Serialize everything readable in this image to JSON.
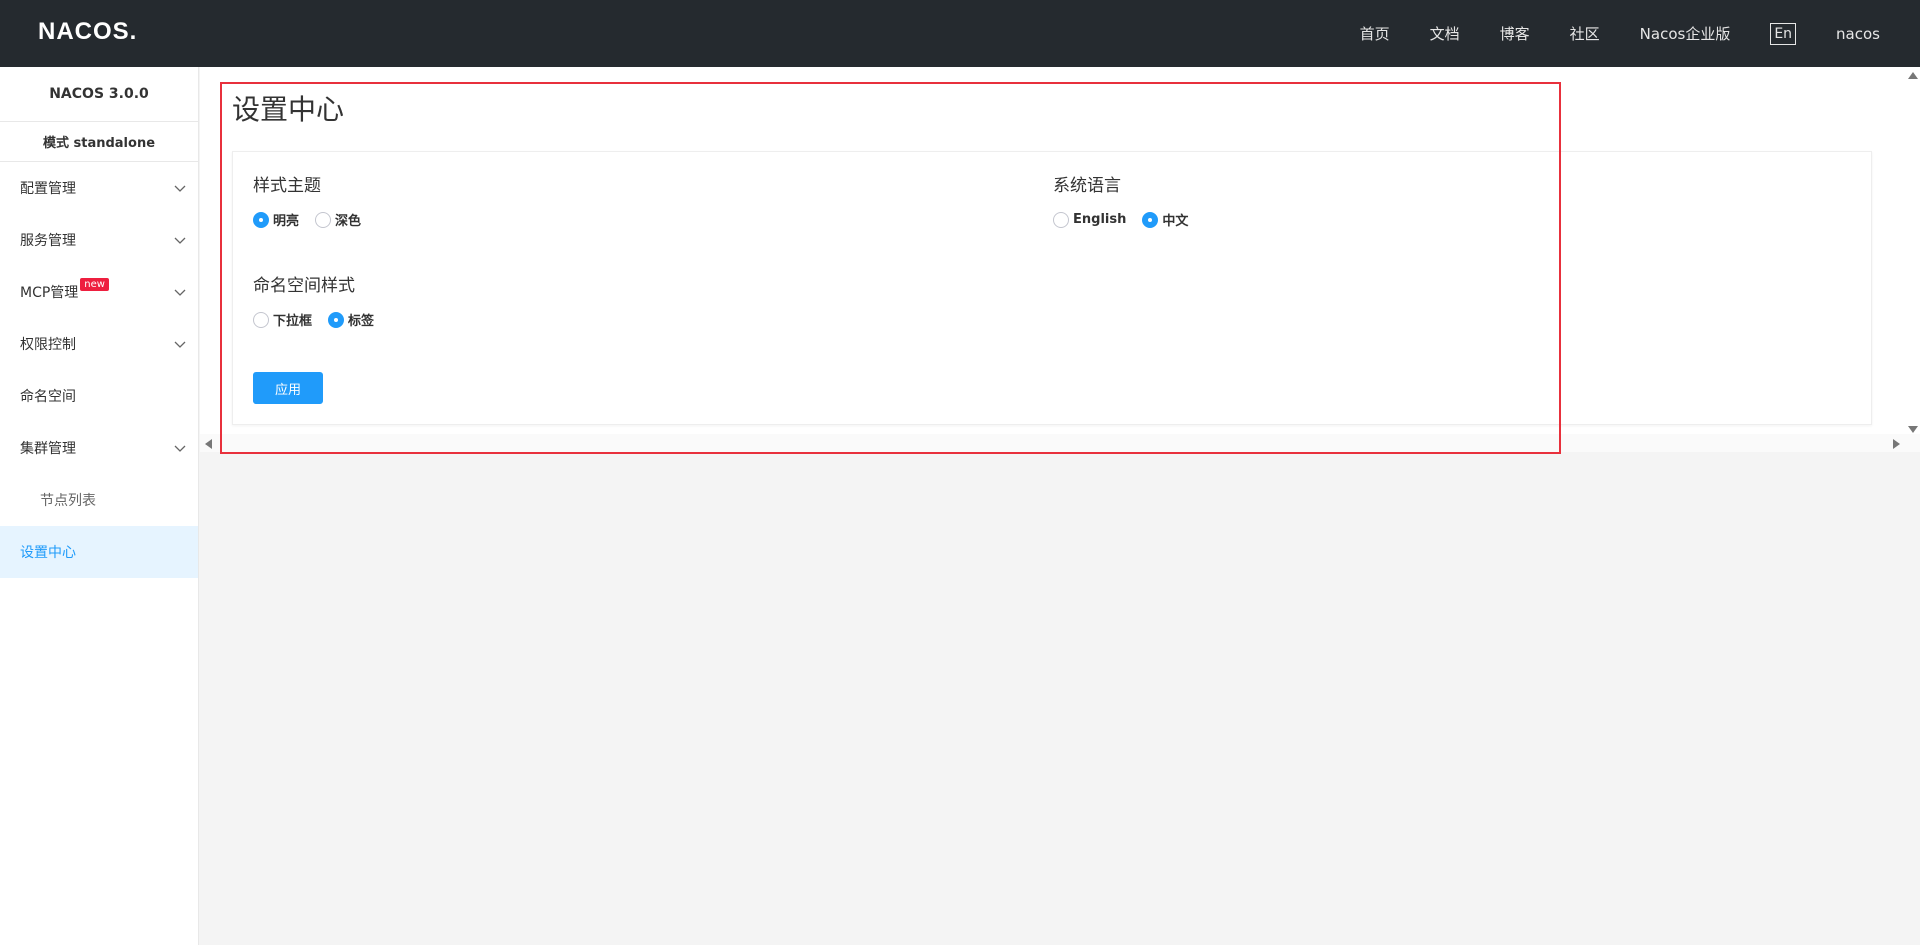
{
  "header": {
    "logo_text": "NACOS",
    "logo_dot": ".",
    "nav": [
      {
        "label": "首页"
      },
      {
        "label": "文档"
      },
      {
        "label": "博客"
      },
      {
        "label": "社区"
      },
      {
        "label": "Nacos企业版"
      }
    ],
    "lang_button": "En",
    "user": "nacos"
  },
  "sidebar": {
    "title": "NACOS 3.0.0",
    "mode": "模式 standalone",
    "items": [
      {
        "label": "配置管理"
      },
      {
        "label": "服务管理"
      },
      {
        "label": "MCP管理",
        "badge": "new"
      },
      {
        "label": "权限控制"
      },
      {
        "label": "命名空间"
      },
      {
        "label": "集群管理"
      },
      {
        "label": "节点列表"
      },
      {
        "label": "设置中心"
      }
    ]
  },
  "main": {
    "title": "设置中心",
    "theme": {
      "title": "样式主题",
      "options": [
        {
          "label": "明亮",
          "checked": true
        },
        {
          "label": "深色",
          "checked": false
        }
      ]
    },
    "language": {
      "title": "系统语言",
      "options": [
        {
          "label": "English",
          "checked": false
        },
        {
          "label": "中文",
          "checked": true
        }
      ]
    },
    "namespace_style": {
      "title": "命名空间样式",
      "options": [
        {
          "label": "下拉框",
          "checked": false
        },
        {
          "label": "标签",
          "checked": true
        }
      ]
    },
    "apply_button": "应用"
  },
  "colors": {
    "accent": "#209bfa",
    "header_bg": "#252a2f",
    "badge": "#ee1f3f",
    "highlight": "#e8303c"
  }
}
